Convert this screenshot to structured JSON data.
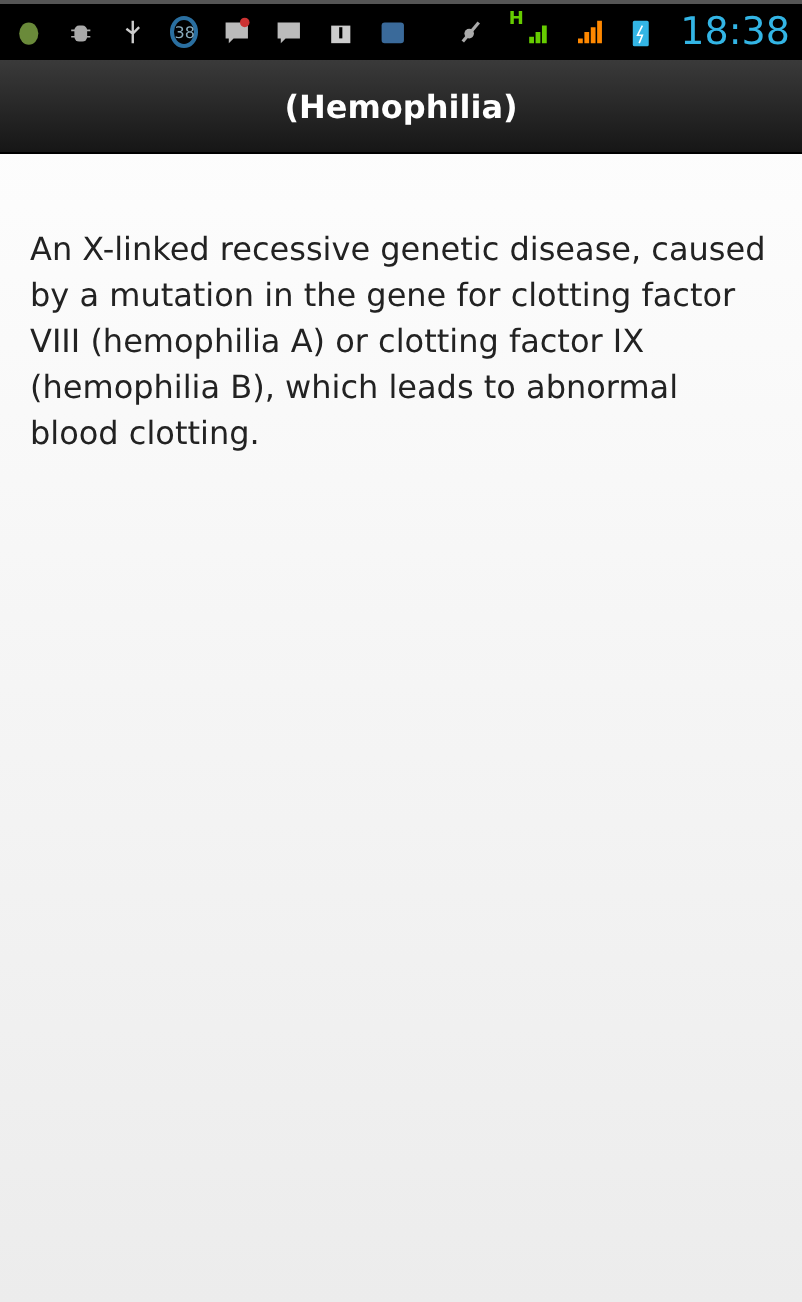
{
  "status_bar": {
    "message_count": "38",
    "network_type": "H",
    "time": "18:38"
  },
  "title_bar": {
    "title": "(Hemophilia)"
  },
  "content": {
    "definition": "An X-linked recessive genetic disease, caused by a mutation in the gene for clotting factor VIII (hemophilia A) or clotting factor IX (hemophilia B), which leads to abnormal blood clotting."
  }
}
